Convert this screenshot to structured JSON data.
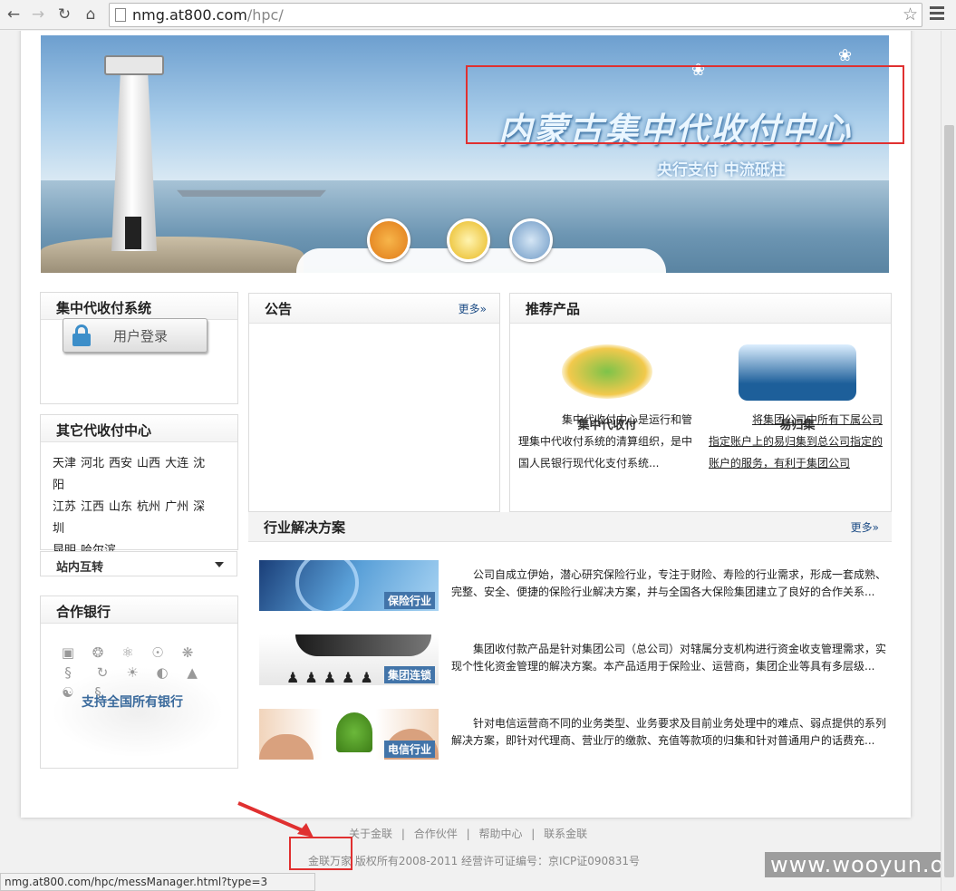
{
  "browser": {
    "url_host": "nmg.at800.com",
    "url_path": "/hpc/"
  },
  "banner": {
    "title": "内蒙古集中代收付中心",
    "subtitle": "央行支付 中流砥柱"
  },
  "left": {
    "system_title": "集中代收付系统",
    "login_label": "用户登录",
    "other_title": "其它代收付中心",
    "cities": [
      "天津",
      "河北",
      "西安",
      "山西",
      "大连",
      "沈阳",
      "江苏",
      "江西",
      "山东",
      "杭州",
      "广州",
      "深圳",
      "昆明",
      "哈尔滨"
    ],
    "select_label": "站内互转",
    "bank_title": "合作银行",
    "bank_support": "支持全国所有银行"
  },
  "notice": {
    "title": "公告",
    "more": "更多»"
  },
  "products": {
    "title": "推荐产品",
    "items": [
      {
        "name": "集中代收付",
        "desc": "集中代收付中心是运行和管理集中代收付系统的清算组织，是中国人民银行现代化支付系统..."
      },
      {
        "name": "易归集",
        "desc": "将集团公司中所有下属公司指定账户上的易归集到总公司指定的账户的服务，有利于集团公司"
      }
    ]
  },
  "solutions": {
    "title": "行业解决方案",
    "more": "更多»",
    "items": [
      {
        "tag": "保险行业",
        "text": "公司自成立伊始，潜心研究保险行业，专注于财险、寿险的行业需求，形成一套成熟、完整、安全、便捷的保险行业解决方案，并与全国各大保险集团建立了良好的合作关系..."
      },
      {
        "tag": "集团连锁",
        "text": "集团收付款产品是针对集团公司（总公司）对辖属分支机构进行资金收支管理需求，实现个性化资金管理的解决方案。本产品适用于保险业、运营商，集团企业等具有多层级..."
      },
      {
        "tag": "电信行业",
        "text": "针对电信运营商不同的业务类型、业务要求及目前业务处理中的难点、弱点提供的系列解决方案，即针对代理商、营业厅的缴款、充值等款项的归集和针对普通用户的话费充..."
      }
    ]
  },
  "footer": {
    "links": [
      "关于金联",
      "|",
      "合作伙伴",
      "|",
      "帮助中心",
      "|",
      "联系金联"
    ],
    "copyright": "金联万家 版权所有2008-2011 经营许可证编号：京ICP证090831号"
  },
  "status_url": "nmg.at800.com/hpc/messManager.html?type=3",
  "watermark": "www.wooyun.org"
}
